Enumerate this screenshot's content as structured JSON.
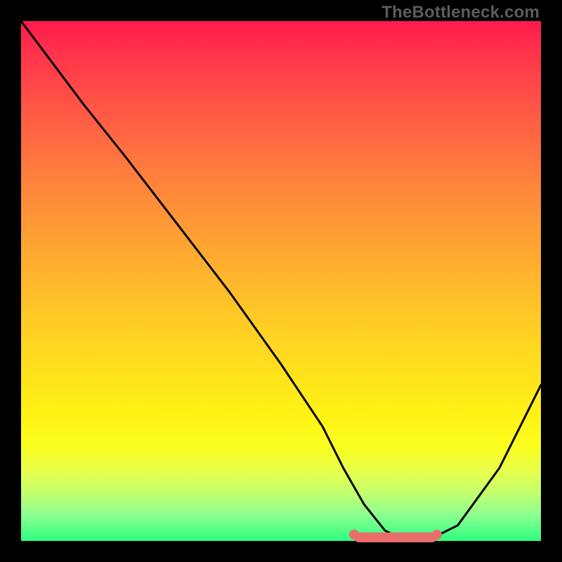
{
  "watermark": "TheBottleneck.com",
  "chart_data": {
    "type": "line",
    "title": "",
    "xlabel": "",
    "ylabel": "",
    "xlim": [
      0,
      100
    ],
    "ylim": [
      0,
      100
    ],
    "series": [
      {
        "name": "curve",
        "x": [
          0,
          6,
          12,
          20,
          30,
          40,
          50,
          58,
          62,
          66,
          70,
          74,
          78,
          84,
          92,
          100
        ],
        "y": [
          100,
          92,
          84,
          74,
          61,
          48,
          34,
          22,
          14,
          7,
          2,
          0,
          0,
          3,
          14,
          30
        ]
      }
    ],
    "highlight_region": {
      "x_start": 64,
      "x_end": 80,
      "y": 0
    },
    "gradient_stops": [
      {
        "pos": 0,
        "color": "#ff1a4d"
      },
      {
        "pos": 50,
        "color": "#ffcc25"
      },
      {
        "pos": 85,
        "color": "#fbff20"
      },
      {
        "pos": 100,
        "color": "#2dff7f"
      }
    ]
  },
  "colors": {
    "frame": "#000000",
    "curve": "#000000",
    "highlight": "#e96e6a",
    "watermark": "#5c5c5c"
  }
}
